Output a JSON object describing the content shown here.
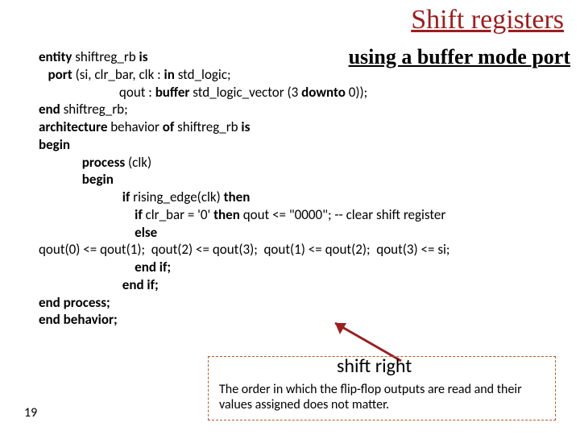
{
  "title": "Shift registers",
  "subtitle": "using a buffer mode port",
  "code": {
    "l1a": "entity",
    "l1b": " shiftreg_rb ",
    "l1c": "is",
    "l2a": "   port ",
    "l2b": "(si, clr_bar, clk : ",
    "l2c": "in ",
    "l2d": "std_logic;",
    "l3a": "                          qout : ",
    "l3b": "buffer ",
    "l3c": "std_logic_vector (3 ",
    "l3d": "downto ",
    "l3e": "0));",
    "l4a": "end ",
    "l4b": "shiftreg_rb;",
    "l5a": "architecture ",
    "l5b": "behavior ",
    "l5c": "of ",
    "l5d": "shiftreg_rb ",
    "l5e": "is",
    "l6": "begin",
    "l7a": "              process ",
    "l7b": "(clk)",
    "l8": "              begin",
    "l9a": "                           if ",
    "l9b": "rising_edge(clk) ",
    "l9c": "then",
    "l10a": "                               if ",
    "l10b": "clr_bar = '0' ",
    "l10c": "then ",
    "l10d": "qout <= \"0000\"; -- clear shift register",
    "l11": "                               else",
    "l12": "qout(0) <= qout(1);  qout(2) <= qout(3);  qout(1) <= qout(2);  qout(3) <= si;",
    "l13": "                               end if;",
    "l14": "                           end if;",
    "l15": "end process;",
    "l16": "end behavior;"
  },
  "annotation": {
    "label": "shift right",
    "text": "The order in which the flip-flop outputs are read and their values assigned does not matter."
  },
  "slide_number": "19"
}
